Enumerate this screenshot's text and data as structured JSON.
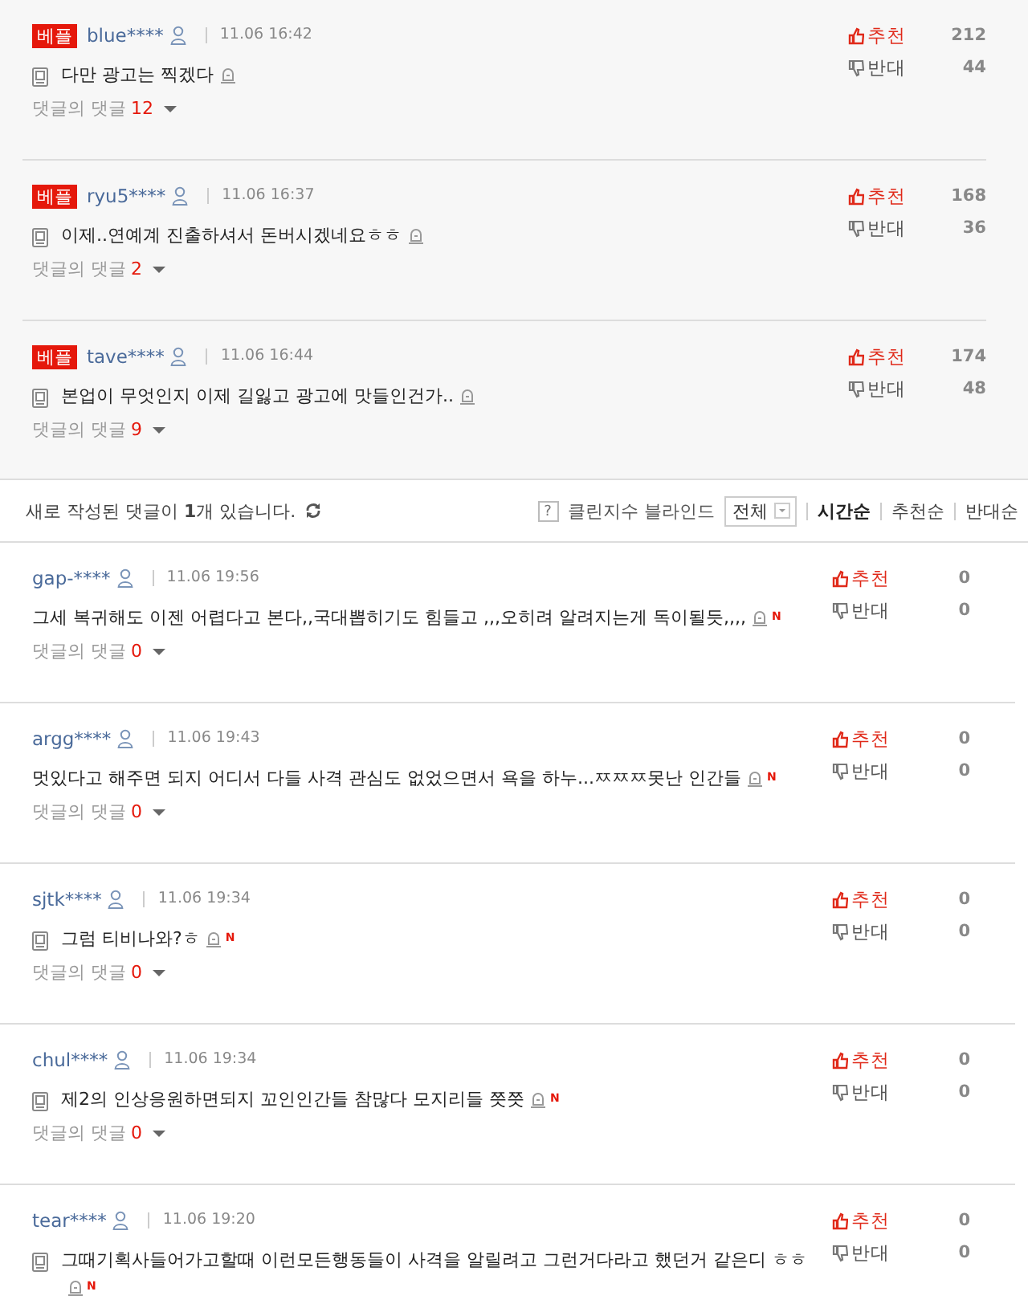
{
  "best_comments": [
    {
      "badge": "베플",
      "user": "blue****",
      "time": "11.06 16:42",
      "mobile": true,
      "text": "다만 광고는 찍겠다",
      "reply_label": "댓글의 댓글",
      "reply_count": "12",
      "up_label": "추천",
      "up_count": "212",
      "down_label": "반대",
      "down_count": "44"
    },
    {
      "badge": "베플",
      "user": "ryu5****",
      "time": "11.06 16:37",
      "mobile": true,
      "text": "이제..연예계 진출하셔서 돈버시겠네요ㅎㅎ",
      "reply_label": "댓글의 댓글",
      "reply_count": "2",
      "up_label": "추천",
      "up_count": "168",
      "down_label": "반대",
      "down_count": "36"
    },
    {
      "badge": "베플",
      "user": "tave****",
      "time": "11.06 16:44",
      "mobile": true,
      "text": "본업이 무엇인지 이제 길잃고 광고에 맛들인건가..",
      "reply_label": "댓글의 댓글",
      "reply_count": "9",
      "up_label": "추천",
      "up_count": "174",
      "down_label": "반대",
      "down_count": "48"
    }
  ],
  "toolbar": {
    "notice": "새로 작성된 댓글이 **1**개 있습니다.",
    "help": "?",
    "filter_label": "클린지수 블라인드",
    "dropdown": "전체",
    "sorts": [
      {
        "label": "시간순",
        "selected": true
      },
      {
        "label": "추천순",
        "selected": false
      },
      {
        "label": "반대순",
        "selected": false
      }
    ]
  },
  "comments": [
    {
      "user": "gap-****",
      "time": "11.06 19:56",
      "mobile": false,
      "text": "그세 복귀해도 이젠 어렵다고 본다,,국대뽑히기도 힘들고 ,,,오히려 알려지는게 독이될듯,,,,",
      "new_mark": "N",
      "reply_label": "댓글의 댓글",
      "reply_count": "0",
      "up_label": "추천",
      "up_count": "0",
      "down_label": "반대",
      "down_count": "0"
    },
    {
      "user": "argg****",
      "time": "11.06 19:43",
      "mobile": false,
      "text": "멋있다고 해주면 되지 어디서 다들 사격 관심도 없었으면서 욕을 하누...ㅉㅉㅉ못난 인간들",
      "new_mark": "N",
      "reply_label": "댓글의 댓글",
      "reply_count": "0",
      "up_label": "추천",
      "up_count": "0",
      "down_label": "반대",
      "down_count": "0"
    },
    {
      "user": "sjtk****",
      "time": "11.06 19:34",
      "mobile": true,
      "text": "그럼 티비나와?ㅎ",
      "new_mark": "N",
      "reply_label": "댓글의 댓글",
      "reply_count": "0",
      "up_label": "추천",
      "up_count": "0",
      "down_label": "반대",
      "down_count": "0"
    },
    {
      "user": "chul****",
      "time": "11.06 19:34",
      "mobile": true,
      "text": "제2의 인상응원하면되지 꼬인인간들 참많다 모지리들 쯧쯧",
      "new_mark": "N",
      "reply_label": "댓글의 댓글",
      "reply_count": "0",
      "up_label": "추천",
      "up_count": "0",
      "down_label": "반대",
      "down_count": "0"
    },
    {
      "user": "tear****",
      "time": "11.06 19:20",
      "mobile": true,
      "text": "그때기획사들어가고할때 이런모든행동들이 사격을 알릴려고 그런거다라고 했던거 같은디 ㅎㅎ",
      "new_mark": "N",
      "up_label": "추천",
      "up_count": "0",
      "down_label": "반대",
      "down_count": "0"
    }
  ]
}
